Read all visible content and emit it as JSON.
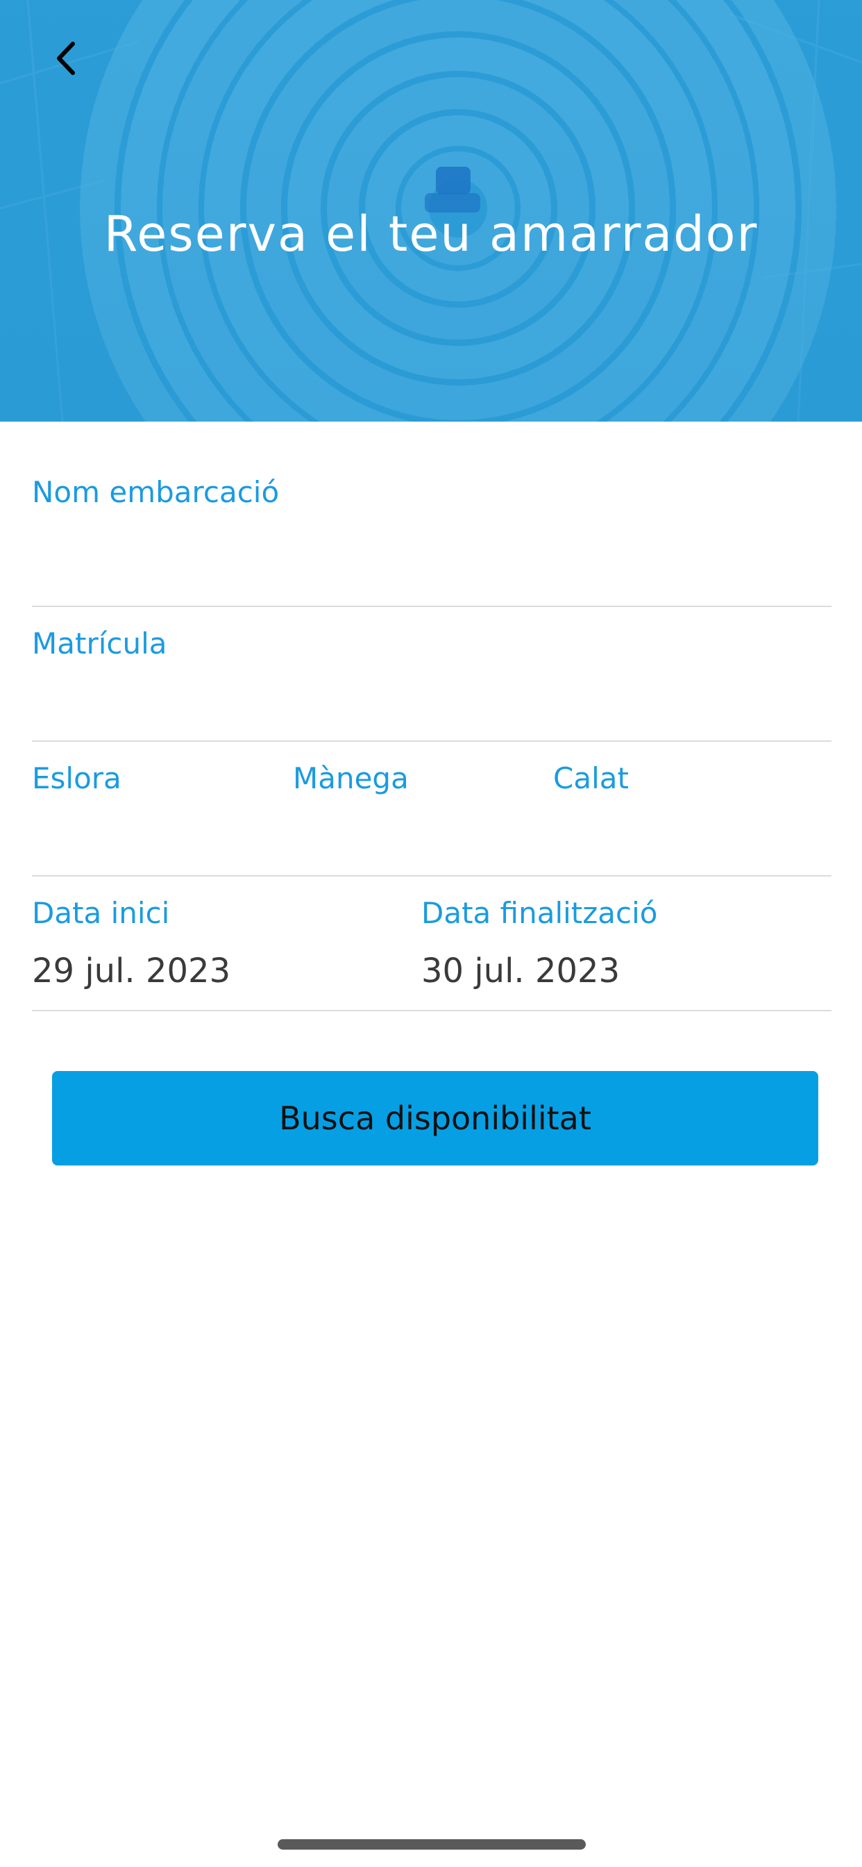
{
  "header": {
    "title": "Reserva el teu amarrador",
    "back_icon": "chevron-left-icon",
    "background_color": "#2f9fd8"
  },
  "form": {
    "boat_name": {
      "label": "Nom embarcació",
      "value": ""
    },
    "registration": {
      "label": "Matrícula",
      "value": ""
    },
    "length": {
      "label": "Eslora",
      "value": ""
    },
    "beam": {
      "label": "Mànega",
      "value": ""
    },
    "draft": {
      "label": "Calat",
      "value": ""
    },
    "start_date": {
      "label": "Data inici",
      "value": "29 jul. 2023"
    },
    "end_date": {
      "label": "Data finalització",
      "value": "30 jul. 2023"
    }
  },
  "actions": {
    "search_label": "Busca disponibilitat",
    "button_color": "#079fe3"
  },
  "colors": {
    "accent": "#1a9be0",
    "divider": "#dcdcdc"
  }
}
